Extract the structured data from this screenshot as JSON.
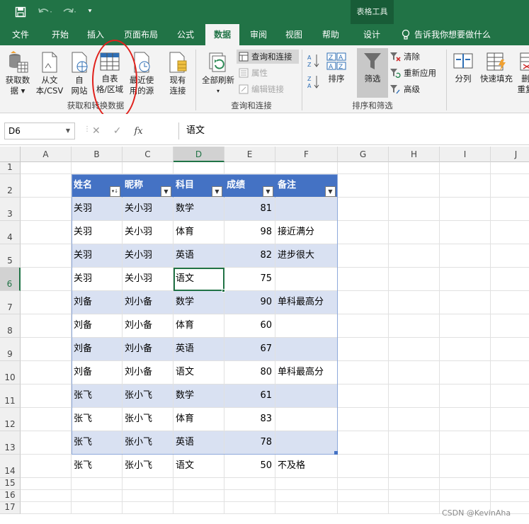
{
  "qat": {
    "save_icon": "save-icon",
    "undo_icon": "undo-icon",
    "redo_icon": "redo-icon",
    "customize_icon": "chevron-down-icon"
  },
  "context_tab_group": "表格工具",
  "tabs": [
    {
      "label": "文件"
    },
    {
      "label": "开始"
    },
    {
      "label": "插入"
    },
    {
      "label": "页面布局"
    },
    {
      "label": "公式"
    },
    {
      "label": "数据",
      "active": true
    },
    {
      "label": "审阅"
    },
    {
      "label": "视图"
    },
    {
      "label": "帮助"
    },
    {
      "label": "设计"
    }
  ],
  "tell_me": "告诉我你想要做什么",
  "ribbon": {
    "get_transform": {
      "get_data_l1": "获取数",
      "get_data_l2": "据 ▾",
      "from_text_l1": "从文",
      "from_text_l2": "本/CSV",
      "from_web_l1": "自",
      "from_web_l2": "网站",
      "from_table_l1": "自表",
      "from_table_l2": "格/区域",
      "recent_l1": "最近使",
      "recent_l2": "用的源",
      "existing_l1": "现有",
      "existing_l2": "连接",
      "group_label": "获取和转换数据"
    },
    "queries": {
      "refresh_l1": "全部刷新",
      "refresh_l2": "▾",
      "queries_connections": "查询和连接",
      "properties": "属性",
      "edit_links": "编辑链接",
      "group_label": "查询和连接"
    },
    "sort_filter": {
      "sort": "排序",
      "filter": "筛选",
      "clear": "清除",
      "reapply": "重新应用",
      "advanced": "高级",
      "group_label": "排序和筛选"
    },
    "tools": {
      "split": "分列",
      "flash_fill": "快速填充",
      "remove_dup_l1": "删",
      "remove_dup_l2": "重复"
    }
  },
  "formula_bar": {
    "name_box": "D6",
    "formula": "语文"
  },
  "sheet": {
    "columns": [
      "A",
      "B",
      "C",
      "D",
      "E",
      "F",
      "G",
      "H",
      "I",
      "J"
    ],
    "rows": [
      "1",
      "2",
      "3",
      "4",
      "5",
      "6",
      "7",
      "8",
      "9",
      "10",
      "11",
      "12",
      "13",
      "14",
      "15",
      "16",
      "17"
    ],
    "headers": [
      "姓名",
      "昵称",
      "科目",
      "成绩",
      "备注"
    ],
    "data": [
      [
        "关羽",
        "关小羽",
        "数学",
        "81",
        ""
      ],
      [
        "关羽",
        "关小羽",
        "体育",
        "98",
        "接近满分"
      ],
      [
        "关羽",
        "关小羽",
        "英语",
        "82",
        "进步很大"
      ],
      [
        "关羽",
        "关小羽",
        "语文",
        "75",
        ""
      ],
      [
        "刘备",
        "刘小备",
        "数学",
        "90",
        "单科最高分"
      ],
      [
        "刘备",
        "刘小备",
        "体育",
        "60",
        ""
      ],
      [
        "刘备",
        "刘小备",
        "英语",
        "67",
        ""
      ],
      [
        "刘备",
        "刘小备",
        "语文",
        "80",
        "单科最高分"
      ],
      [
        "张飞",
        "张小飞",
        "数学",
        "61",
        ""
      ],
      [
        "张飞",
        "张小飞",
        "体育",
        "83",
        ""
      ],
      [
        "张飞",
        "张小飞",
        "英语",
        "78",
        ""
      ],
      [
        "张飞",
        "张小飞",
        "语文",
        "50",
        "不及格"
      ]
    ]
  },
  "watermark": "CSDN @KevinAha",
  "colors": {
    "excel_green": "#217346",
    "table_header": "#4472c4",
    "band": "#d9e1f2",
    "annotation_red": "#e0201b"
  }
}
